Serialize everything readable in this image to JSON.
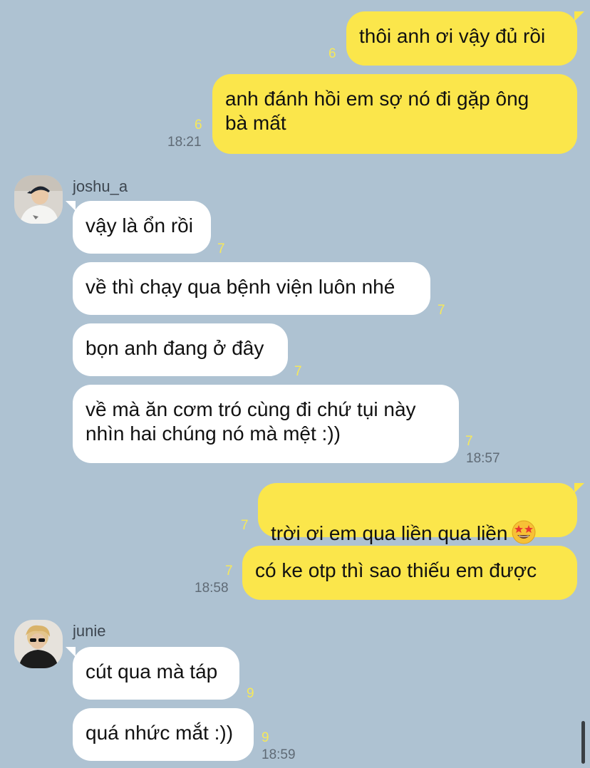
{
  "messages": {
    "m1": {
      "text": "thôi anh ơi vậy đủ rồi",
      "read": "6"
    },
    "m2": {
      "text": "anh đánh hồi em sợ nó đi gặp ông\nbà mất",
      "read": "6",
      "time": "18:21"
    },
    "joshua": {
      "name": "joshu_a"
    },
    "m3": {
      "text": "vậy là ổn rồi",
      "read": "7"
    },
    "m4": {
      "text": "về thì chạy qua bệnh viện luôn nhé",
      "read": "7"
    },
    "m5": {
      "text": "bọn anh đang ở đây",
      "read": "7"
    },
    "m6": {
      "text": "về mà ăn cơm tró cùng đi chứ tụi này\nnhìn hai chúng nó mà mệt :))",
      "read": "7",
      "time": "18:57"
    },
    "m7": {
      "text": "trời ơi em qua liền qua liền",
      "read": "7",
      "emoji": "star-struck-emoji"
    },
    "m8": {
      "text": "có ke otp thì sao thiếu em được",
      "read": "7",
      "time": "18:58"
    },
    "junie": {
      "name": "junie"
    },
    "m9": {
      "text": "cút qua mà táp",
      "read": "9"
    },
    "m10": {
      "text": "quá nhức mắt :))",
      "read": "9",
      "time": "18:59"
    }
  },
  "colors": {
    "background": "#aec2d2",
    "sent_bubble": "#fbe64b",
    "received_bubble": "#ffffff",
    "read_count": "#f6e85a"
  }
}
